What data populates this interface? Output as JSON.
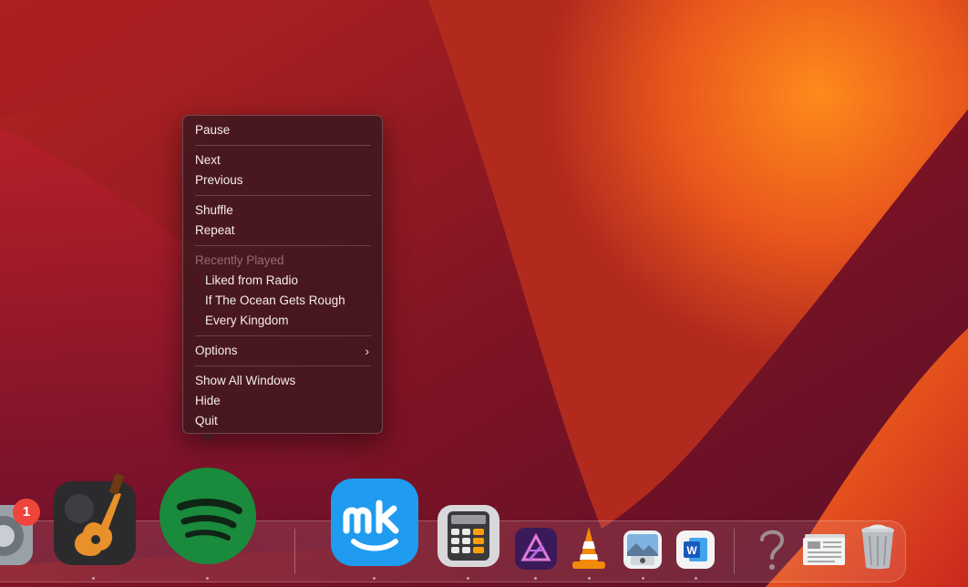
{
  "context_menu": {
    "items": [
      {
        "label": "Pause"
      },
      {
        "label": "Next"
      },
      {
        "label": "Previous"
      },
      {
        "label": "Shuffle"
      },
      {
        "label": "Repeat"
      },
      {
        "label": "Recently Played"
      },
      {
        "label": "Liked from Radio"
      },
      {
        "label": "If The Ocean Gets Rough"
      },
      {
        "label": "Every Kingdom"
      },
      {
        "label": "Options"
      },
      {
        "label": "Show All Windows"
      },
      {
        "label": "Hide"
      },
      {
        "label": "Quit"
      }
    ]
  },
  "dock": {
    "apps": [
      {
        "name": "System Settings",
        "icon": "settings-gear-icon",
        "badge": "1"
      },
      {
        "name": "GarageBand",
        "icon": "guitar-icon"
      },
      {
        "name": "Spotify",
        "icon": "spotify-icon"
      },
      {
        "name": "MeisterTask",
        "icon": "mk-logo-icon"
      },
      {
        "name": "Calculator",
        "icon": "calculator-icon"
      },
      {
        "name": "Affinity Photo",
        "icon": "affinity-photo-icon"
      },
      {
        "name": "VLC",
        "icon": "traffic-cone-icon"
      },
      {
        "name": "Preview",
        "icon": "preview-photos-icon"
      },
      {
        "name": "Microsoft Word",
        "icon": "word-icon"
      },
      {
        "name": "Help",
        "icon": "question-mark-icon"
      },
      {
        "name": "Documents",
        "icon": "documents-stack-icon"
      },
      {
        "name": "Trash",
        "icon": "trash-icon"
      }
    ]
  },
  "colors": {
    "menu_bg": "#42181e",
    "spotify_green": "#1db954",
    "badge_red": "#f0453c",
    "mk_blue": "#1f9bf0"
  }
}
